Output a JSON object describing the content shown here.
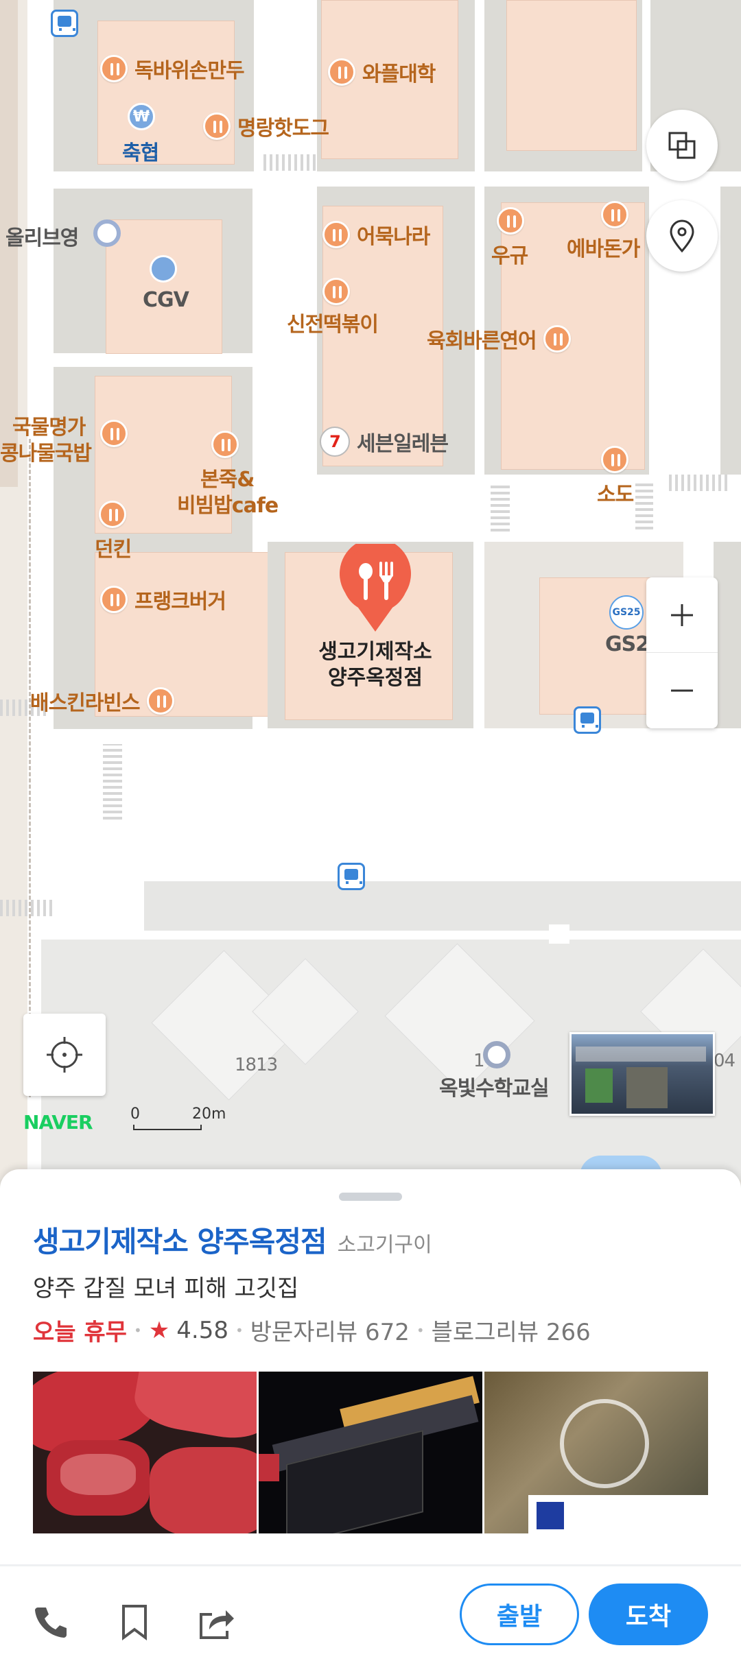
{
  "map": {
    "pois": [
      {
        "name": "독바위손만두"
      },
      {
        "name": "와플대학"
      },
      {
        "name": "명랑핫도그"
      },
      {
        "name": "어묵나라"
      },
      {
        "name": "신전떡볶이"
      },
      {
        "name": "우규"
      },
      {
        "name": "에바돈가"
      },
      {
        "name": "육회바른연어"
      },
      {
        "name": "국물명가"
      },
      {
        "name": "콩나물국밥"
      },
      {
        "name": "본죽&"
      },
      {
        "name": "비빔밥cafe"
      },
      {
        "name": "던킨"
      },
      {
        "name": "소도"
      },
      {
        "name": "프랭크버거"
      },
      {
        "name": "배스킨라빈스"
      },
      {
        "name": "세븐일레븐"
      },
      {
        "name": "CGV"
      },
      {
        "name": "축협"
      },
      {
        "name": "올리브영"
      },
      {
        "name": "GS25"
      },
      {
        "name": "GS2"
      },
      {
        "name": "옥빛수학교실"
      },
      {
        "name": "1813"
      },
      {
        "name": "04"
      },
      {
        "name": "1"
      }
    ],
    "selected_marker": {
      "line1": "생고기제작소",
      "line2": "양주옥정점"
    },
    "brand": "NAVER",
    "scale": {
      "zero": "0",
      "distance": "20m"
    },
    "controls": [
      "layers-icon",
      "location-pin-icon",
      "zoom-in-icon",
      "zoom-out-icon",
      "current-location-icon"
    ]
  },
  "place": {
    "name": "생고기제작소 양주옥정점",
    "category": "소고기구이",
    "description": "양주 갑질 모녀 피해 고깃집",
    "status": "오늘 휴무",
    "rating_star": "★",
    "rating": "4.58",
    "visitor_reviews": "방문자리뷰 672",
    "blog_reviews": "블로그리뷰 266",
    "photos": [
      "meat-photo",
      "storefront-night-photo",
      "interior-door-photo"
    ]
  },
  "actions": {
    "depart": "출발",
    "arrive": "도착",
    "icons": [
      "phone-icon",
      "bookmark-icon",
      "share-icon"
    ]
  },
  "colors": {
    "accent": "#1e8cf3",
    "title": "#1b64c8",
    "closed": "#e0353b",
    "marker": "#f06149"
  }
}
